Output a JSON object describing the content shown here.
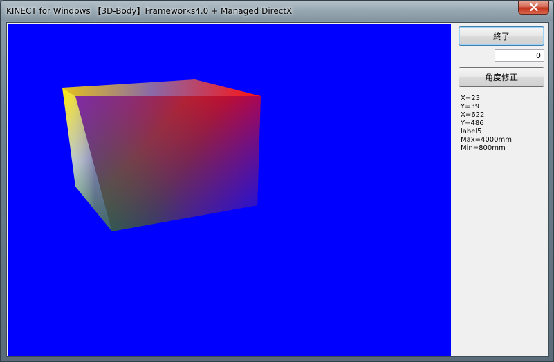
{
  "window": {
    "title": "KINECT for Windpws 【3D-Body】Frameworks4.0 + Managed DirectX"
  },
  "controls": {
    "exit_button_label": "終了",
    "value_field": "0",
    "angle_button_label": "角度修正"
  },
  "info_labels": [
    "X=23",
    "Y=39",
    "X=622",
    "Y=486",
    "label5",
    "Max=4000mm",
    "Min=800mm"
  ],
  "colors": {
    "viewport_background": "#0000ff",
    "cube_red": "#ff0000",
    "cube_yellow": "#ffe600",
    "cube_green": "#008000",
    "cube_blue": "#0000ff"
  },
  "icons": {
    "close": "close-icon"
  }
}
